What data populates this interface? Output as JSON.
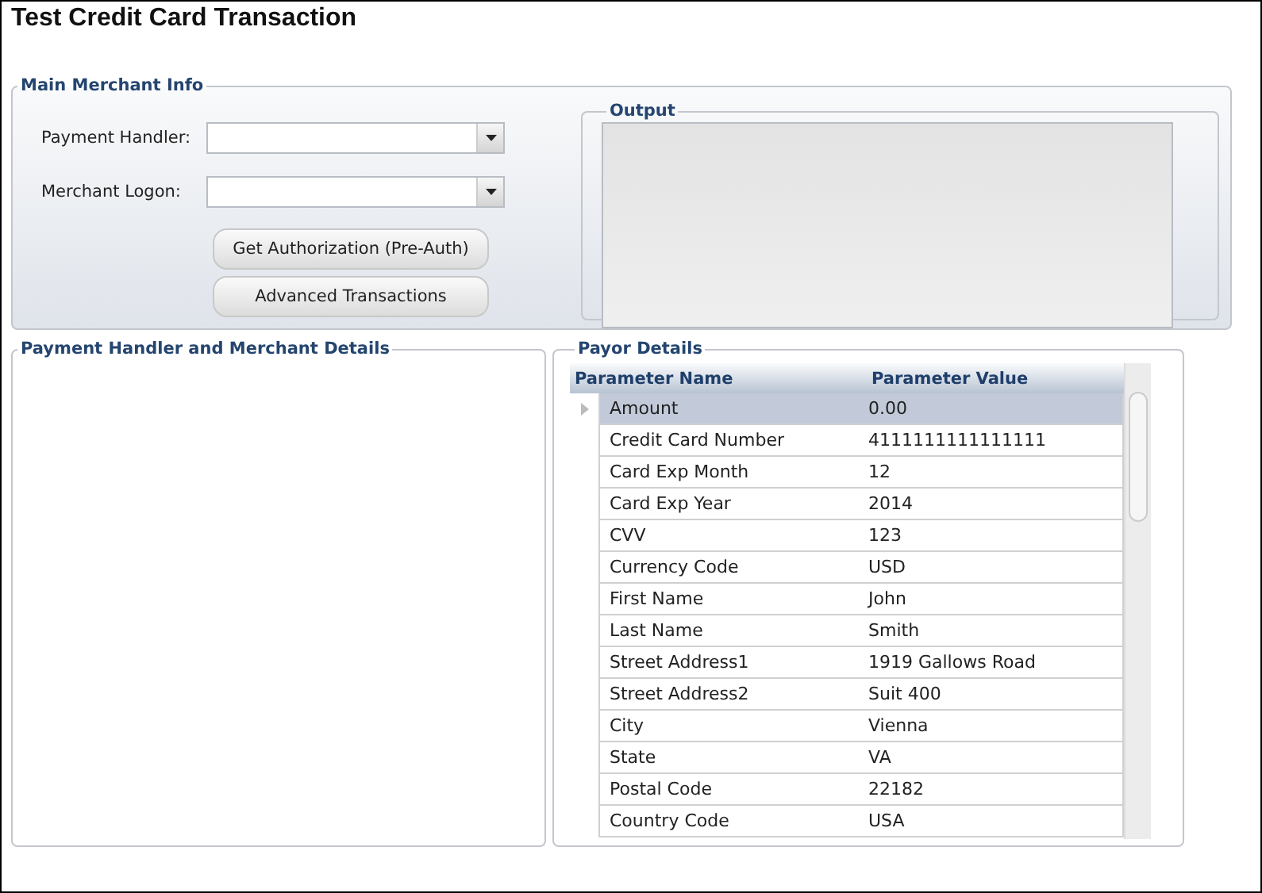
{
  "title": "Test Credit Card Transaction",
  "main_merchant_info": {
    "legend": "Main Merchant Info",
    "fields": [
      {
        "label": "Payment Handler:"
      },
      {
        "label": "Merchant Logon:"
      }
    ],
    "buttons": [
      "Get Authorization (Pre-Auth)",
      "Advanced Transactions"
    ],
    "output": {
      "legend": "Output"
    }
  },
  "handler_details": {
    "legend": "Payment Handler and Merchant Details"
  },
  "payor_details": {
    "legend": "Payor Details",
    "columns": [
      "Parameter Name",
      "Parameter Value"
    ],
    "rows": [
      {
        "name": "Amount",
        "value": "0.00",
        "selected": true
      },
      {
        "name": "Credit Card Number",
        "value": "4111111111111111",
        "selected": false
      },
      {
        "name": "Card Exp Month",
        "value": "12",
        "selected": false
      },
      {
        "name": "Card Exp Year",
        "value": "2014",
        "selected": false
      },
      {
        "name": "CVV",
        "value": "123",
        "selected": false
      },
      {
        "name": "Currency Code",
        "value": "USD",
        "selected": false
      },
      {
        "name": "First Name",
        "value": "John",
        "selected": false
      },
      {
        "name": "Last Name",
        "value": "Smith",
        "selected": false
      },
      {
        "name": "Street Address1",
        "value": "1919 Gallows Road",
        "selected": false
      },
      {
        "name": "Street Address2",
        "value": "Suit 400",
        "selected": false
      },
      {
        "name": "City",
        "value": "Vienna",
        "selected": false
      },
      {
        "name": "State",
        "value": "VA",
        "selected": false
      },
      {
        "name": "Postal Code",
        "value": "22182",
        "selected": false
      },
      {
        "name": "Country Code",
        "value": "USA",
        "selected": false
      }
    ]
  }
}
